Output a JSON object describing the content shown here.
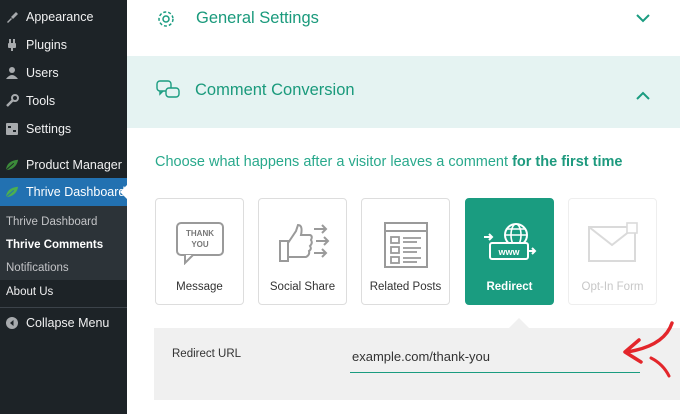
{
  "sidebar": {
    "items": [
      {
        "label": "Appearance",
        "icon": "appearance-icon"
      },
      {
        "label": "Plugins",
        "icon": "plugins-icon"
      },
      {
        "label": "Users",
        "icon": "users-icon"
      },
      {
        "label": "Tools",
        "icon": "tools-icon"
      },
      {
        "label": "Settings",
        "icon": "settings-icon"
      },
      {
        "label": "Product Manager",
        "icon": "leaf-icon"
      },
      {
        "label": "Thrive Dashboard",
        "icon": "leaf-icon",
        "active": true
      }
    ],
    "submenu": [
      "Thrive Dashboard",
      "Thrive Comments",
      "Notifications"
    ],
    "submenu_current": "Thrive Comments",
    "about": "About Us",
    "collapse": "Collapse Menu"
  },
  "main": {
    "general_title": "General Settings",
    "cc_title": "Comment Conversion",
    "prompt": "Choose what happens after a visitor leaves a comment",
    "prompt_bold": "for the first time",
    "options": [
      {
        "label": "Message",
        "art_text": "THANK YOU"
      },
      {
        "label": "Social Share"
      },
      {
        "label": "Related Posts"
      },
      {
        "label": "Redirect",
        "art_text": "www",
        "selected": true
      },
      {
        "label": "Opt-In Form",
        "disabled": true
      }
    ],
    "redirect_label": "Redirect URL",
    "redirect_value": "example.com/thank-you"
  },
  "colors": {
    "accent": "#1a9c80",
    "sidebar_bg": "#1d2327",
    "active_blue": "#2271b1",
    "annotation_red": "#e3262b"
  }
}
